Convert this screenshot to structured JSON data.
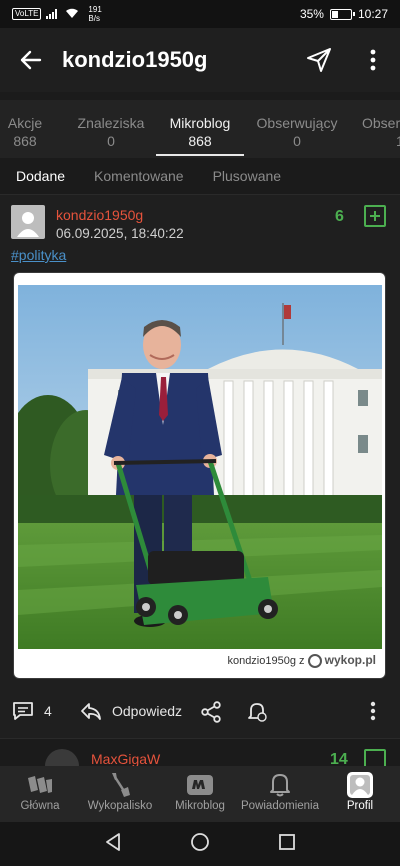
{
  "status_bar": {
    "hd": "VoLTE",
    "speed_value": "191",
    "speed_unit": "B/s",
    "battery": "35%",
    "battery_level": 0.35,
    "time": "10:27"
  },
  "app_bar": {
    "title": "kondzio1950g",
    "icons": [
      "back-arrow-icon",
      "send-icon",
      "more-vertical-icon"
    ]
  },
  "tabs": [
    {
      "label": "Akcje",
      "count": "868"
    },
    {
      "label": "Znaleziska",
      "count": "0"
    },
    {
      "label": "Mikroblog",
      "count": "868",
      "active": true
    },
    {
      "label": "Obserwujący",
      "count": "0"
    },
    {
      "label": "Obser",
      "count": "1"
    }
  ],
  "subtabs": [
    {
      "label": "Dodane",
      "active": true
    },
    {
      "label": "Komentowane"
    },
    {
      "label": "Plusowane"
    }
  ],
  "entry": {
    "author": "kondzio1950g",
    "date": "06.09.2025, 18:40:22",
    "votes": "6",
    "tag": "#polityka",
    "watermark_user": "kondzio1950g",
    "watermark_z": "z",
    "watermark_site": "wykop.pl",
    "comments_count": "4",
    "reply_label": "Odpowiedz"
  },
  "next_entry": {
    "author": "MaxGigaW",
    "votes": "14"
  },
  "bottom_nav": [
    {
      "label": "Główna",
      "icon": "wykop-logo-icon"
    },
    {
      "label": "Wykopalisko",
      "icon": "shovel-icon"
    },
    {
      "label": "Mikroblog",
      "icon": "mikroblog-icon"
    },
    {
      "label": "Powiadomienia",
      "icon": "bell-icon"
    },
    {
      "label": "Profil",
      "icon": "profile-icon",
      "active": true
    }
  ],
  "colors": {
    "accent_green": "#4caf50",
    "author_red": "#e6533c",
    "tag_blue": "#4a90c8",
    "background": "#1b1b1b"
  }
}
